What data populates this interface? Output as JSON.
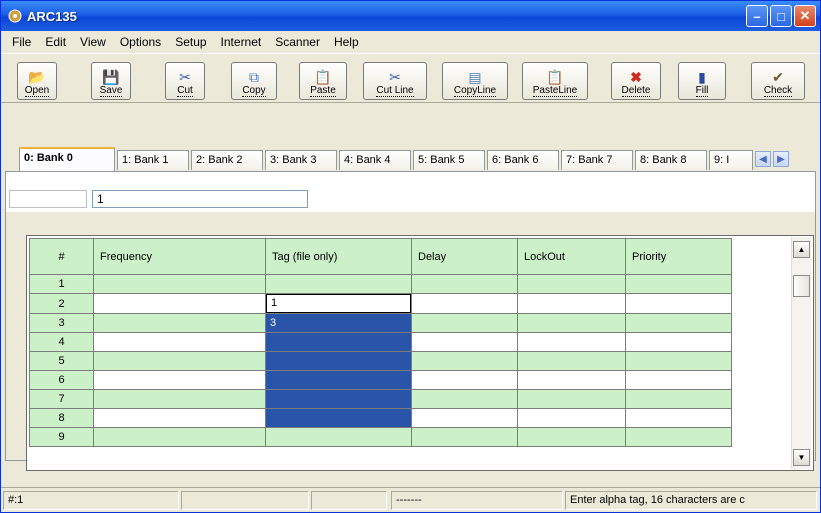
{
  "window": {
    "title": "ARC135"
  },
  "menu": [
    "File",
    "Edit",
    "View",
    "Options",
    "Setup",
    "Internet",
    "Scanner",
    "Help"
  ],
  "toolbar": [
    {
      "label": "Open",
      "icon": "open-folder-icon"
    },
    {
      "label": "Save",
      "icon": "save-disk-icon"
    },
    {
      "label": "Cut",
      "icon": "scissors-icon"
    },
    {
      "label": "Copy",
      "icon": "copy-icon"
    },
    {
      "label": "Paste",
      "icon": "paste-icon"
    },
    {
      "label": "Cut Line",
      "icon": "scissors-icon"
    },
    {
      "label": "CopyLine",
      "icon": "copy-line-icon"
    },
    {
      "label": "PasteLine",
      "icon": "paste-line-icon"
    },
    {
      "label": "Delete",
      "icon": "delete-x-icon"
    },
    {
      "label": "Fill",
      "icon": "fill-icon"
    },
    {
      "label": "Check",
      "icon": "check-broom-icon"
    }
  ],
  "tabs": [
    {
      "label": "0: Bank 0",
      "active": true
    },
    {
      "label": "1: Bank 1"
    },
    {
      "label": "2: Bank 2"
    },
    {
      "label": "3: Bank 3"
    },
    {
      "label": "4: Bank 4"
    },
    {
      "label": "5: Bank 5"
    },
    {
      "label": "6: Bank 6"
    },
    {
      "label": "7: Bank 7"
    },
    {
      "label": "8: Bank 8"
    },
    {
      "label": "9: I"
    }
  ],
  "editor": {
    "tag_value": "1"
  },
  "grid": {
    "columns": [
      "#",
      "Frequency",
      "Tag (file only)",
      "Delay",
      "LockOut",
      "Priority"
    ],
    "rows": [
      {
        "num": "1",
        "tag": ""
      },
      {
        "num": "2",
        "tag": "1"
      },
      {
        "num": "3",
        "tag": "3"
      },
      {
        "num": "4",
        "tag": ""
      },
      {
        "num": "5",
        "tag": ""
      },
      {
        "num": "6",
        "tag": ""
      },
      {
        "num": "7",
        "tag": ""
      },
      {
        "num": "8",
        "tag": ""
      },
      {
        "num": "9",
        "tag": ""
      }
    ]
  },
  "status": {
    "position": "#:1",
    "field3": "-------",
    "message": "Enter alpha tag, 16 characters are c"
  },
  "colors": {
    "title_bar": "#0a46d6",
    "row_green": "#ccf0c8",
    "selection": "#2a54a8"
  }
}
